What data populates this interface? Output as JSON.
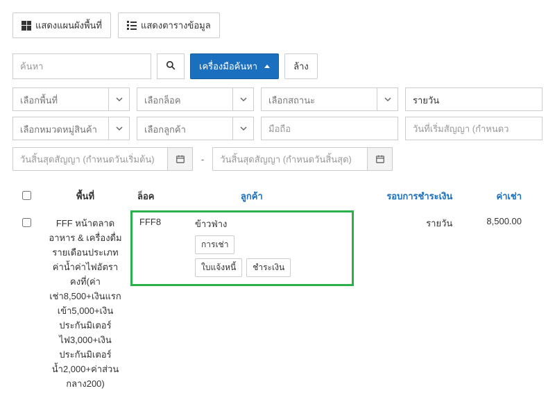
{
  "topButtons": {
    "showMap": "แสดงแผนผังพื้นที่",
    "showTable": "แสดงตารางข้อมูล"
  },
  "search": {
    "placeholder": "ค้นหา",
    "toolsLabel": "เครื่องมือค้นหา",
    "clearLabel": "ล้าง"
  },
  "filters": {
    "area": "เลือกพื้นที่",
    "lock": "เลือกล็อค",
    "status": "เลือกสถานะ",
    "period": "รายวัน",
    "category": "เลือกหมวดหมู่สินค้า",
    "customer": "เลือกลูกค้า",
    "mobile": "มือถือ",
    "contractStart": "วันที่เริ่มสัญญา (กำหนดว"
  },
  "dates": {
    "endStart": "วันสิ้นสุดสัญญา (กำหนดวันเริ่มต้น)",
    "endEnd": "วันสิ้นสุดสัญญา (กำหนดวันสิ้นสุด)",
    "dash": "-"
  },
  "table": {
    "headers": {
      "area": "พื้นที่",
      "lock": "ล็อค",
      "customer": "ลูกค้า",
      "paymentCycle": "รอบการชำระเงิน",
      "rent": "ค่าเช่า"
    },
    "rows": [
      {
        "area": "FFF หน้าตลาด อาหาร & เครื่องดื่ม รายเดือนประเภทค่าน้ำค่าไฟอัตราคงที่(ค่าเช่า8,500+เงินแรกเข้า5,000+เงินประกันมิเตอร์ไฟ3,000+เงินประกันมิเตอร์น้ำ2,000+ค่าส่วนกลาง200)",
        "lock": "FFF8",
        "customerName": "ข้าวฟ่าง",
        "actions": {
          "rent": "การเช่า",
          "invoice": "ใบแจ้งหนี้",
          "pay": "ชำระเงิน"
        },
        "paymentCycle": "รายวัน",
        "rent": "8,500.00"
      }
    ]
  }
}
